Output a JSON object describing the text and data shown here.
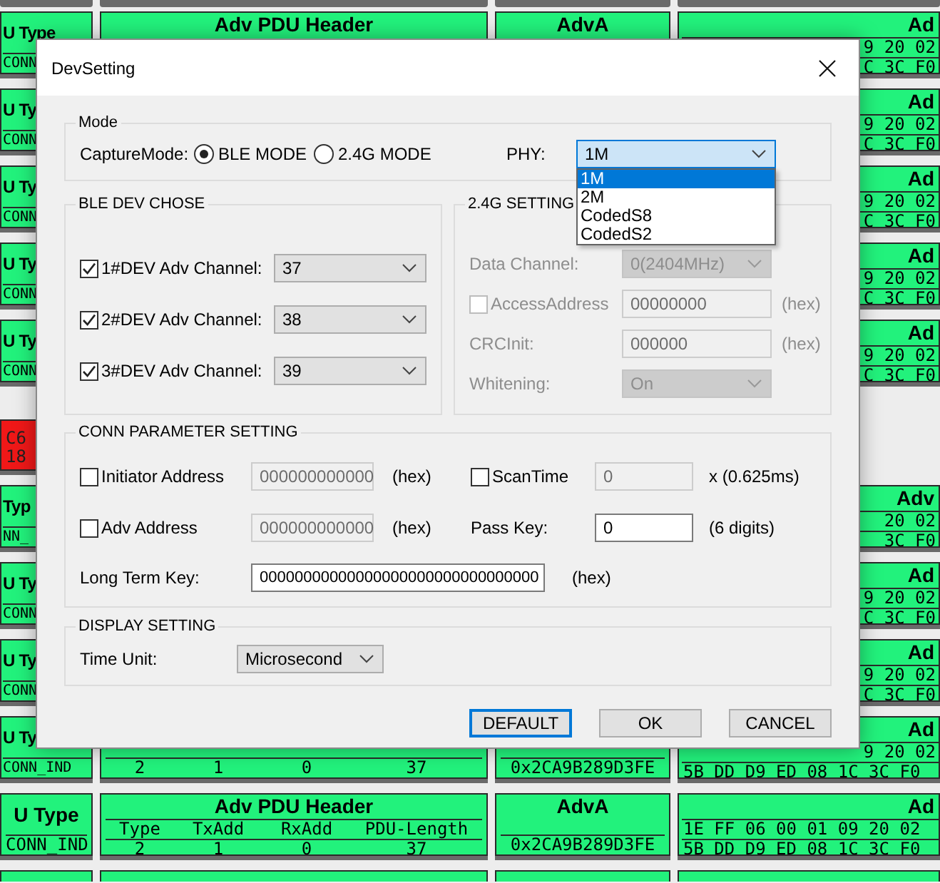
{
  "background": {
    "rows": [
      {
        "kind": "shadow"
      },
      {
        "kind": "head",
        "type_title": "U Type",
        "type_value": "CONN",
        "header_title": "Adv PDU Header",
        "adva_title": "AdvA",
        "data_title": "Ad",
        "data_lines": [
          "9 20 02",
          "C 3C F0"
        ]
      },
      {
        "kind": "edge",
        "type_title": "U Ty",
        "type_value": "CONN",
        "data_title": "Ad",
        "data_lines": [
          "9 20 02",
          "C 3C F0"
        ]
      },
      {
        "kind": "edge",
        "type_title": "U Ty",
        "type_value": "CONN",
        "data_title": "Ad",
        "data_lines": [
          "9 20 02",
          "C 3C F0"
        ]
      },
      {
        "kind": "edge",
        "type_title": "U Ty",
        "type_value": "CONN",
        "data_title": "Ad",
        "data_lines": [
          "9 20 02",
          "C 3C F0"
        ]
      },
      {
        "kind": "edge",
        "type_title": "U Ty",
        "type_value": "CONN",
        "data_title": "Ad",
        "data_lines": [
          "9 20 02",
          "C 3C F0"
        ]
      },
      {
        "kind": "alert",
        "lines": [
          "C6",
          "18"
        ]
      },
      {
        "kind": "edge",
        "type_title": "Typ",
        "type_value": "NN_",
        "data_title": "Adv",
        "data_lines": [
          "20 02",
          "3C F0"
        ]
      },
      {
        "kind": "edge",
        "type_title": "U Ty",
        "type_value": "CONN",
        "data_title": "Ad",
        "data_lines": [
          "9 20 02",
          "C 3C F0"
        ]
      },
      {
        "kind": "edge",
        "type_title": "U Ty",
        "type_value": "CONN",
        "data_title": "Ad",
        "data_lines": [
          "9 20 02",
          "C 3C F0"
        ]
      },
      {
        "kind": "tail",
        "type_title": "U Ty",
        "type_value": "CONN_IND",
        "header_values": [
          "2",
          "1",
          "0",
          "37"
        ],
        "adva_value": "0x2CA9B289D3FE",
        "data_title": "Ad",
        "data_lines": [
          "9 20 02",
          "5B DD D9 ED 08 1C 3C F0"
        ]
      },
      {
        "kind": "full",
        "type_title": "U Type",
        "type_value": "CONN_IND",
        "header_title": "Adv PDU Header",
        "header_fields": [
          "Type",
          "TxAdd",
          "RxAdd",
          "PDU-Length"
        ],
        "header_values": [
          "2",
          "1",
          "0",
          "37"
        ],
        "adva_title": "AdvA",
        "adva_value": "0x2CA9B289D3FE",
        "data_title": "Ad",
        "data_lines": [
          "1E FF 06 00 01 09 20 02",
          "5B DD D9 ED 08 1C 3C F0"
        ]
      },
      {
        "kind": "cut"
      }
    ]
  },
  "dialog": {
    "title": "DevSetting",
    "mode": {
      "legend": "Mode",
      "capture_label": "CaptureMode:",
      "options": [
        {
          "label": "BLE MODE",
          "selected": true
        },
        {
          "label": "2.4G MODE",
          "selected": false
        }
      ],
      "phy_label": "PHY:",
      "phy": {
        "value": "1M",
        "expanded": true,
        "options": [
          {
            "label": "1M",
            "selected": true
          },
          {
            "label": "2M",
            "selected": false
          },
          {
            "label": "CodedS8",
            "selected": false
          },
          {
            "label": "CodedS2",
            "selected": false
          }
        ]
      }
    },
    "ble_dev": {
      "legend": "BLE DEV CHOSE",
      "channels": [
        {
          "label": "1#DEV Adv Channel:",
          "checked": true,
          "value": "37"
        },
        {
          "label": "2#DEV Adv Channel:",
          "checked": true,
          "value": "38"
        },
        {
          "label": "3#DEV Adv Channel:",
          "checked": true,
          "value": "39"
        }
      ]
    },
    "setting_24g": {
      "legend": "2.4G SETTING",
      "disabled": true,
      "rows": [
        {
          "kind": "combo",
          "label": "Data Channel:",
          "value": "0(2404MHz)"
        },
        {
          "kind": "check",
          "label": "AccessAddress",
          "checked": false,
          "value": "00000000",
          "unit": "(hex)"
        },
        {
          "kind": "field",
          "label": "CRCInit:",
          "value": "000000",
          "unit": "(hex)"
        },
        {
          "kind": "combo",
          "label": "Whitening:",
          "value": "On"
        }
      ]
    },
    "conn": {
      "legend": "CONN PARAMETER SETTING",
      "rows": [
        [
          {
            "kind": "check",
            "label": "Initiator Address",
            "checked": false,
            "value": "000000000000",
            "disabled": true,
            "unit": "(hex)"
          },
          {
            "kind": "check",
            "label": "ScanTime",
            "checked": false,
            "value": "0",
            "disabled": true,
            "unit": "x (0.625ms)"
          }
        ],
        [
          {
            "kind": "check",
            "label": "Adv Address",
            "checked": false,
            "value": "000000000000",
            "disabled": true,
            "unit": "(hex)"
          },
          {
            "kind": "label",
            "label": "Pass Key:",
            "value": "0",
            "disabled": false,
            "unit": "(6 digits)"
          }
        ]
      ],
      "long_key": {
        "label": "Long Term Key:",
        "value": "00000000000000000000000000000000",
        "disabled": false,
        "unit": "(hex)"
      }
    },
    "display": {
      "legend": "DISPLAY SETTING",
      "label": "Time Unit:",
      "value": "Microsecond"
    },
    "buttons": [
      {
        "label": "DEFAULT",
        "focused": true
      },
      {
        "label": "OK",
        "focused": false
      },
      {
        "label": "CANCEL",
        "focused": false
      }
    ]
  }
}
